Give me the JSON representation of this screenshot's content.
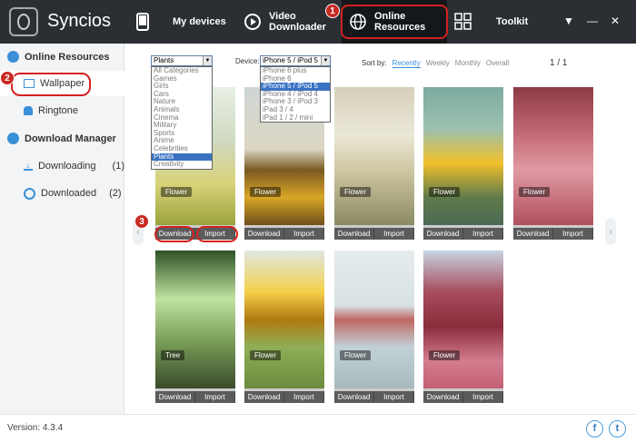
{
  "app": {
    "title": "Syncios",
    "version": "Version: 4.3.4"
  },
  "topnav": {
    "items": [
      {
        "label": "My devices",
        "icon": "phone-icon"
      },
      {
        "label": "Video Downloader",
        "icon": "play-icon"
      },
      {
        "label": "Online Resources",
        "icon": "globe-icon",
        "active": true
      },
      {
        "label": "Toolkit",
        "icon": "grid-icon"
      }
    ],
    "window_controls": [
      "▼",
      "—",
      "✕"
    ]
  },
  "badges": [
    "1",
    "2",
    "3"
  ],
  "sidebar": {
    "online_resources": "Online Resources",
    "wallpaper": "Wallpaper",
    "ringtone": "Ringtone",
    "download_manager": "Download Manager",
    "downloading": "Downloading",
    "downloading_count": "(1)",
    "downloaded": "Downloaded",
    "downloaded_count": "(2)"
  },
  "filters": {
    "category_value": "Plants",
    "categories": [
      "All Categories",
      "Games",
      "Girls",
      "Cars",
      "Nature",
      "Animals",
      "Cinema",
      "Military",
      "Sports",
      "Anime",
      "Celebrities",
      "Plants",
      "Creativity"
    ],
    "device_label": "Device:",
    "device_value": "iPhone 5 / iPod 5",
    "devices": [
      "iPhone 6 plus",
      "iPhone 6",
      "iPhone 5 / iPod 5",
      "iPhone 4 / iPod 4",
      "iPhone 3 / iPod 3",
      "iPad 3 / 4",
      "iPad 1 / 2 / mini"
    ],
    "sort_label": "Sort by:",
    "sort_options": [
      "Recently",
      "Weekly",
      "Monthly",
      "Overall"
    ],
    "pagination": "1 / 1"
  },
  "cards": [
    {
      "tag": "Flower",
      "download": "Download",
      "import": "Import"
    },
    {
      "tag": "Flower",
      "download": "Download",
      "import": "Import"
    },
    {
      "tag": "Flower",
      "download": "Download",
      "import": "Import"
    },
    {
      "tag": "Flower",
      "download": "Download",
      "import": "Import"
    },
    {
      "tag": "Flower",
      "download": "Download",
      "import": "Import"
    },
    {
      "tag": "Tree",
      "download": "Download",
      "import": "Import"
    },
    {
      "tag": "Flower",
      "download": "Download",
      "import": "Import"
    },
    {
      "tag": "Flower",
      "download": "Download",
      "import": "Import"
    },
    {
      "tag": "Flower",
      "download": "Download",
      "import": "Import"
    }
  ],
  "footer": {
    "facebook": "f",
    "twitter": "t"
  },
  "colors": {
    "topbar": "#2b2f33",
    "accent": "#3a8fd9",
    "highlight": "#d42020"
  }
}
